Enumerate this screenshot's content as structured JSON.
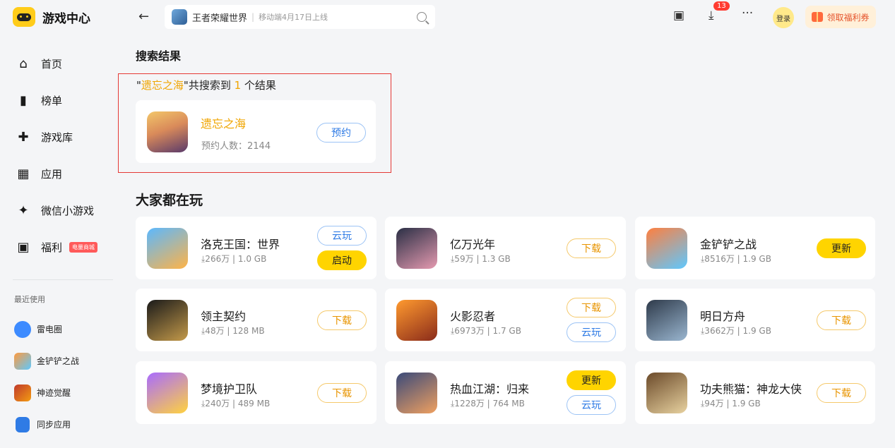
{
  "app": {
    "title": "游戏中心"
  },
  "sidebar": {
    "nav": [
      {
        "label": "首页",
        "icon": "home-icon"
      },
      {
        "label": "榜单",
        "icon": "chart-icon"
      },
      {
        "label": "游戏库",
        "icon": "gamepad-icon"
      },
      {
        "label": "应用",
        "icon": "apps-icon"
      },
      {
        "label": "微信小游戏",
        "icon": "mini-game-icon"
      },
      {
        "label": "福利",
        "icon": "gift-icon",
        "badge": "电量商城"
      }
    ],
    "recent_title": "最近使用",
    "recent": [
      {
        "label": "雷电圈",
        "color": "#3d8bff"
      },
      {
        "label": "金铲铲之战",
        "color": "#ff9a3d"
      },
      {
        "label": "神迹觉醒",
        "color": "#c0392b"
      },
      {
        "label": "同步应用",
        "color": "#2f7be5"
      }
    ]
  },
  "topbar": {
    "search_value": "王者荣耀世界",
    "search_hint": "移动端4月17日上线",
    "download_count": "13",
    "login_label": "登录",
    "welfare_label": "领取福利券"
  },
  "search": {
    "section_title": "搜索结果",
    "summary_quote_open": "\"",
    "keyword": "遗忘之海",
    "summary_mid": "\"共搜索到 ",
    "count": "1",
    "summary_end": " 个结果",
    "result": {
      "name": "遗忘之海",
      "meta": "预约人数：2144",
      "button": "预约"
    }
  },
  "popular": {
    "section_title": "大家都在玩",
    "games": [
      {
        "name": "洛克王国：世界",
        "meta": "⤓266万 | 1.0 GB",
        "buttons": [
          {
            "label": "云玩",
            "style": "blue"
          },
          {
            "label": "启动",
            "style": "yellow"
          }
        ],
        "color1": "#5bb8ff",
        "color2": "#ffb347"
      },
      {
        "name": "亿万光年",
        "meta": "⤓59万 | 1.3 GB",
        "buttons": [
          {
            "label": "下载",
            "style": "orange"
          }
        ],
        "color1": "#2a2f45",
        "color2": "#e59ab0"
      },
      {
        "name": "金铲铲之战",
        "meta": "⤓8516万 | 1.9 GB",
        "buttons": [
          {
            "label": "更新",
            "style": "yellow"
          }
        ],
        "color1": "#ff7f3f",
        "color2": "#5ec8ff"
      },
      {
        "name": "领主契约",
        "meta": "⤓48万 | 128 MB",
        "buttons": [
          {
            "label": "下载",
            "style": "orange"
          }
        ],
        "color1": "#1a1a1a",
        "color2": "#c49a4a"
      },
      {
        "name": "火影忍者",
        "meta": "⤓6973万 | 1.7 GB",
        "buttons": [
          {
            "label": "下载",
            "style": "orange"
          },
          {
            "label": "云玩",
            "style": "blue"
          }
        ],
        "color1": "#ff9a2f",
        "color2": "#8a2b1a"
      },
      {
        "name": "明日方舟",
        "meta": "⤓3662万 | 1.9 GB",
        "buttons": [
          {
            "label": "下载",
            "style": "orange"
          }
        ],
        "color1": "#2e3a4a",
        "color2": "#9ab6d0"
      },
      {
        "name": "梦境护卫队",
        "meta": "⤓240万 | 489 MB",
        "buttons": [
          {
            "label": "下载",
            "style": "orange"
          }
        ],
        "color1": "#a86bff",
        "color2": "#ffd23f"
      },
      {
        "name": "热血江湖：归来",
        "meta": "⤓1228万 | 764 MB",
        "buttons": [
          {
            "label": "更新",
            "style": "yellow"
          },
          {
            "label": "云玩",
            "style": "blue"
          }
        ],
        "color1": "#3a4a7a",
        "color2": "#f0a060"
      },
      {
        "name": "功夫熊猫：神龙大侠",
        "meta": "⤓94万 | 1.9 GB",
        "buttons": [
          {
            "label": "下载",
            "style": "orange"
          }
        ],
        "color1": "#6b4a2a",
        "color2": "#e8d2a0"
      }
    ]
  }
}
